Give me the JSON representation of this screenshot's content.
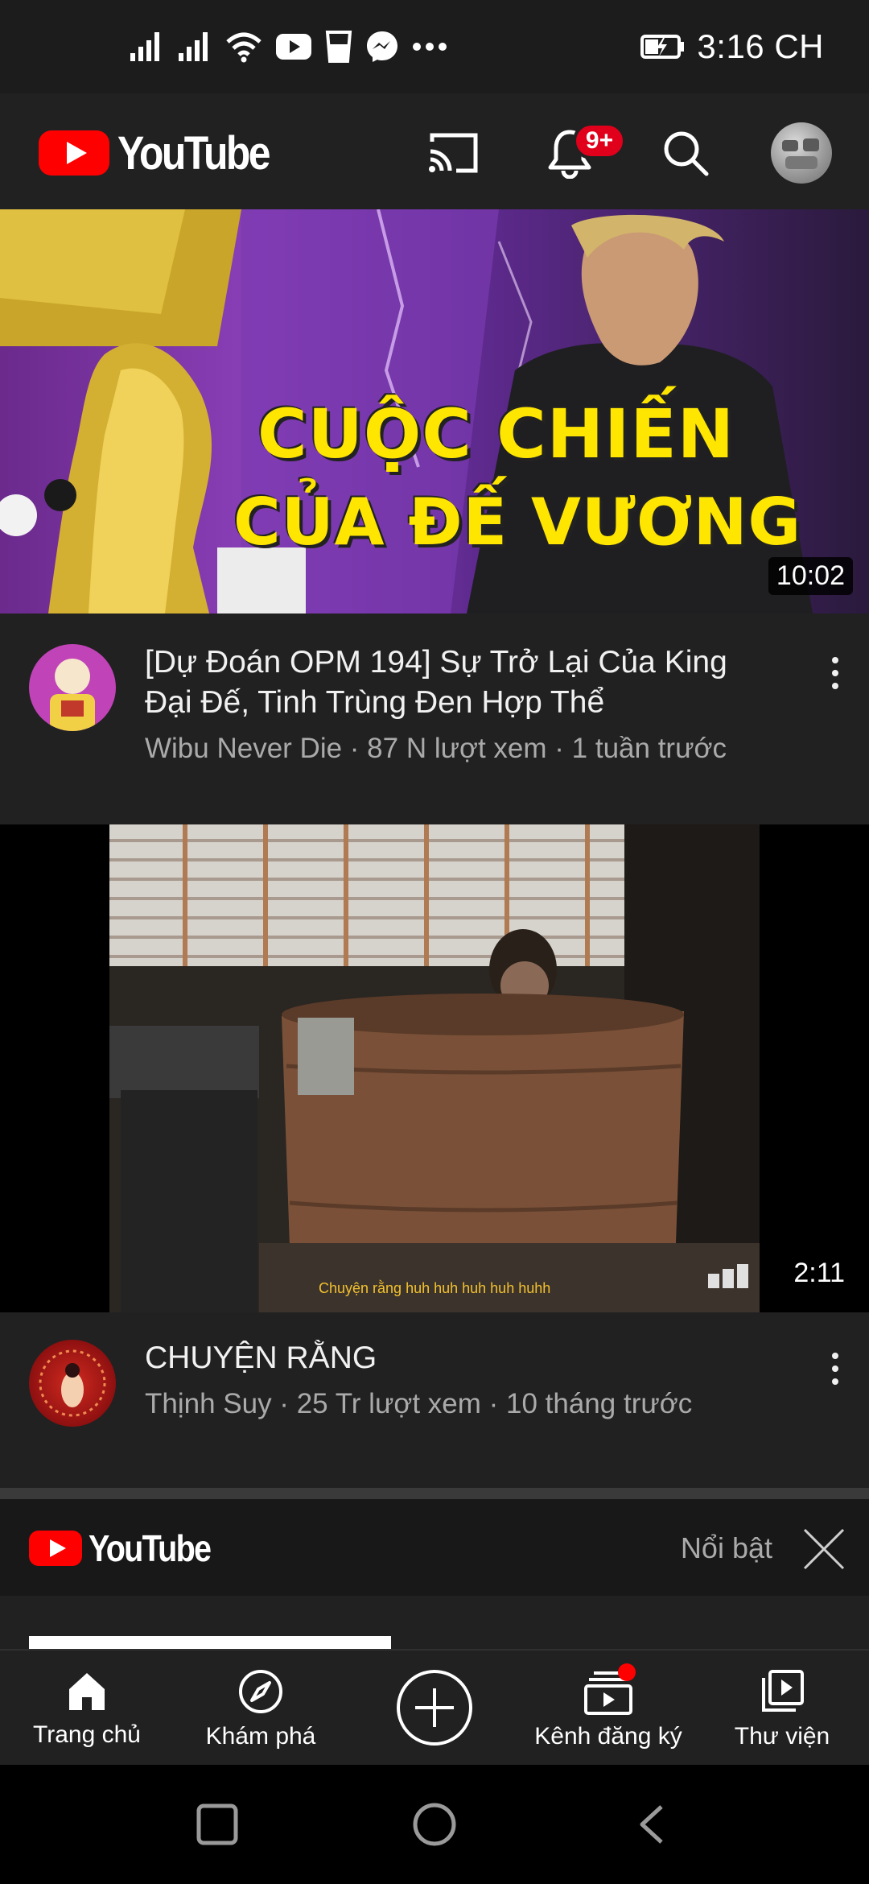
{
  "status_bar": {
    "time": "3:16 CH",
    "icons": [
      "signal-icon",
      "signal-icon",
      "wifi-icon",
      "youtube-notification-icon",
      "cup-icon",
      "messenger-icon",
      "more-icon"
    ],
    "battery": "battery-charging-icon"
  },
  "header": {
    "brand": "YouTube",
    "notification_badge": "9+",
    "actions": [
      "cast-icon",
      "bell-icon",
      "search-icon",
      "account-avatar"
    ]
  },
  "videos": [
    {
      "thumbnail_text_line1": "CUỘC CHIẾN",
      "thumbnail_text_line2": "CỦA ĐẾ VƯƠNG",
      "duration": "10:02",
      "title": "[Dự Đoán OPM 194] Sự Trở Lại Của King Đại Đế, Tinh Trùng Đen Hợp Thể",
      "meta": "Wibu Never Die · 87 N lượt xem · 1 tuần trước"
    },
    {
      "subtitle": "Chuyện rằng huh huh huh huh huhh",
      "duration": "2:11",
      "title": "CHUYỆN RẰNG",
      "meta": "Thịnh Suy · 25 Tr lượt xem · 10 tháng trước"
    }
  ],
  "promo": {
    "brand": "YouTube",
    "label": "Nổi bật"
  },
  "bottom_nav": [
    {
      "label": "Trang chủ",
      "icon": "home-icon",
      "active": true
    },
    {
      "label": "Khám phá",
      "icon": "compass-icon"
    },
    {
      "label": "",
      "icon": "create-icon"
    },
    {
      "label": "Kênh đăng ký",
      "icon": "subscriptions-icon",
      "dot": true
    },
    {
      "label": "Thư viện",
      "icon": "library-icon"
    }
  ],
  "colors": {
    "background": "#212121",
    "youtube_red": "#ff0000",
    "badge_red": "#e0001b",
    "meta_text": "#aaaaaa",
    "thumbnail_text_yellow": "#ffe600"
  }
}
